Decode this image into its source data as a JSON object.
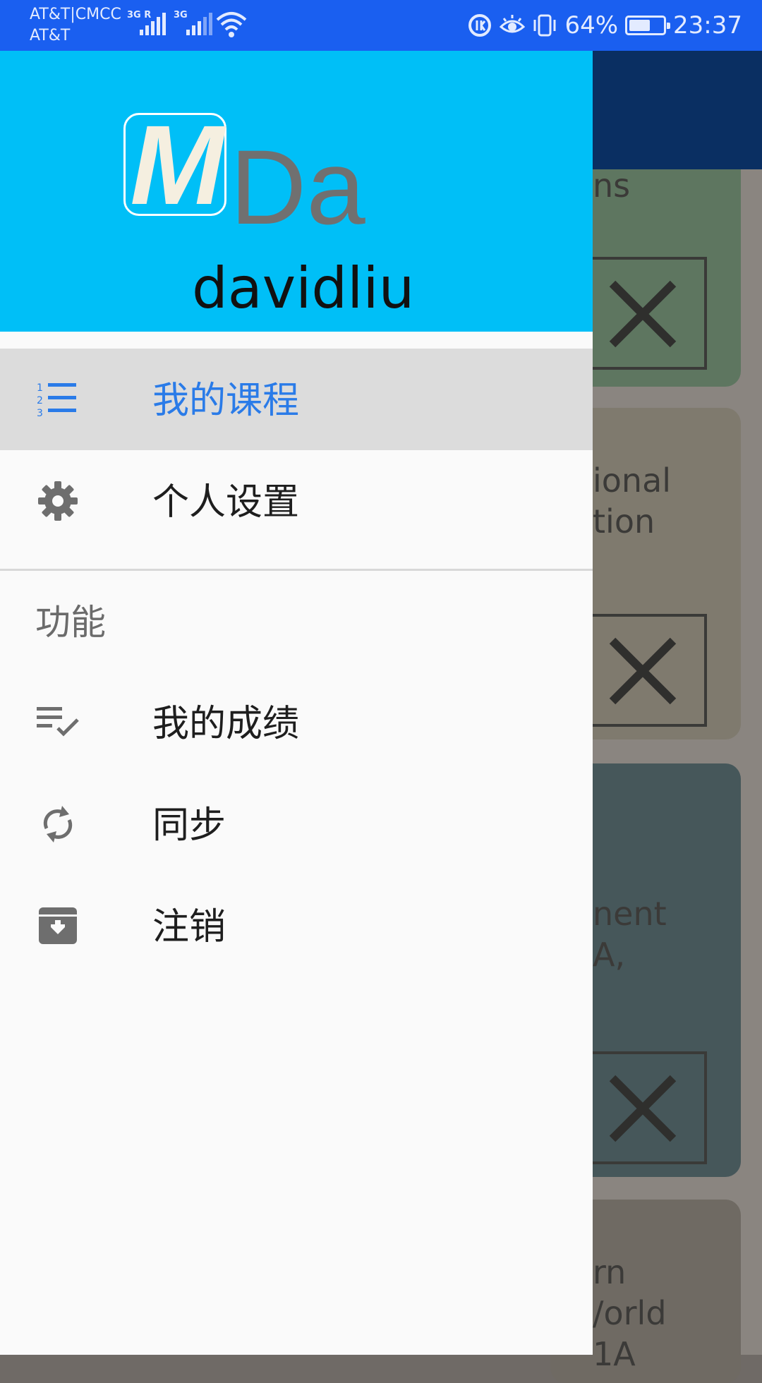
{
  "status_bar": {
    "carrier_line1": "AT&T|CMCC",
    "carrier_line2": "AT&T",
    "sim1_tag": "3G R",
    "sim2_tag": "3G",
    "battery_percent_text": "64%",
    "battery_level": 0.64,
    "time": "23:37",
    "icons": [
      "signal-icon",
      "wifi-icon",
      "data-saver-icon",
      "eye-comfort-icon",
      "vibrate-icon",
      "battery-icon"
    ]
  },
  "drawer": {
    "header": {
      "logo_letter": "M",
      "logo_suffix": "Da",
      "username": "davidliu",
      "background": "#00bff7"
    },
    "items": [
      {
        "label": "我的课程",
        "icon": "numbered-list-icon",
        "selected": true
      },
      {
        "label": "个人设置",
        "icon": "gear-icon",
        "selected": false
      }
    ],
    "section_title": "功能",
    "function_items": [
      {
        "label": "我的成绩",
        "icon": "playlist-check-icon"
      },
      {
        "label": "同步",
        "icon": "sync-icon"
      },
      {
        "label": "注销",
        "icon": "archive-icon"
      }
    ],
    "accent_color": "#2a7be8"
  },
  "background_app": {
    "cards": [
      {
        "text_lines": [
          "ns"
        ]
      },
      {
        "text_lines": [
          "ional",
          "tion"
        ]
      },
      {
        "text_lines": [
          "nent",
          "A,"
        ]
      },
      {
        "text_lines": [
          "rn",
          "/orld",
          "1A"
        ]
      }
    ]
  }
}
